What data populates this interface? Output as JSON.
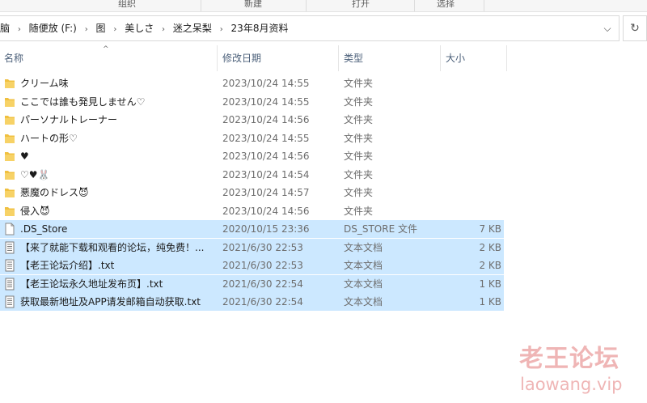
{
  "ribbon": {
    "groups": [
      "组织",
      "新建",
      "打开",
      "选择"
    ]
  },
  "address": {
    "crumbs": [
      "脑",
      "随便放 (F:)",
      "图",
      "美しさ",
      "迷之呆梨",
      "23年8月资料"
    ],
    "separator": "›",
    "dropdown_icon": "⌵",
    "refresh_icon": "↻"
  },
  "columns": {
    "name": "名称",
    "date": "修改日期",
    "type": "类型",
    "size": "大小",
    "sort_arrow": "^"
  },
  "files": [
    {
      "kind": "folder",
      "name": "クリーム味",
      "date": "2023/10/24 14:55",
      "type": "文件夹",
      "size": "",
      "selected": false
    },
    {
      "kind": "folder",
      "name": "ここでは誰も発見しません♡",
      "date": "2023/10/24 14:55",
      "type": "文件夹",
      "size": "",
      "selected": false
    },
    {
      "kind": "folder",
      "name": "パーソナルトレーナー",
      "date": "2023/10/24 14:56",
      "type": "文件夹",
      "size": "",
      "selected": false
    },
    {
      "kind": "folder",
      "name": "ハートの形♡",
      "date": "2023/10/24 14:55",
      "type": "文件夹",
      "size": "",
      "selected": false
    },
    {
      "kind": "folder",
      "name": "♥",
      "date": "2023/10/24 14:56",
      "type": "文件夹",
      "size": "",
      "selected": false
    },
    {
      "kind": "folder",
      "name": "♡♥🐰",
      "date": "2023/10/24 14:54",
      "type": "文件夹",
      "size": "",
      "selected": false
    },
    {
      "kind": "folder",
      "name": "悪魔のドレス😈",
      "date": "2023/10/24 14:57",
      "type": "文件夹",
      "size": "",
      "selected": false
    },
    {
      "kind": "folder",
      "name": "侵入😈",
      "date": "2023/10/24 14:56",
      "type": "文件夹",
      "size": "",
      "selected": false
    },
    {
      "kind": "file",
      "name": ".DS_Store",
      "date": "2020/10/15 23:36",
      "type": "DS_STORE 文件",
      "size": "7 KB",
      "selected": true
    },
    {
      "kind": "text",
      "name": "【来了就能下载和观看的论坛，纯免费！...",
      "date": "2021/6/30 22:53",
      "type": "文本文档",
      "size": "2 KB",
      "selected": true
    },
    {
      "kind": "text",
      "name": "【老王论坛介绍】.txt",
      "date": "2021/6/30 22:53",
      "type": "文本文档",
      "size": "2 KB",
      "selected": true
    },
    {
      "kind": "text",
      "name": "【老王论坛永久地址发布页】.txt",
      "date": "2021/6/30 22:54",
      "type": "文本文档",
      "size": "1 KB",
      "selected": true
    },
    {
      "kind": "text",
      "name": "获取最新地址及APP请发邮箱自动获取.txt",
      "date": "2021/6/30 22:54",
      "type": "文本文档",
      "size": "1 KB",
      "selected": true
    }
  ],
  "watermark": {
    "title": "老王论坛",
    "url": "laowang.vip"
  },
  "colors": {
    "selection": "#cce8ff",
    "folder": "#f0c040",
    "header_text": "#4c607a",
    "watermark": "#e17878"
  }
}
